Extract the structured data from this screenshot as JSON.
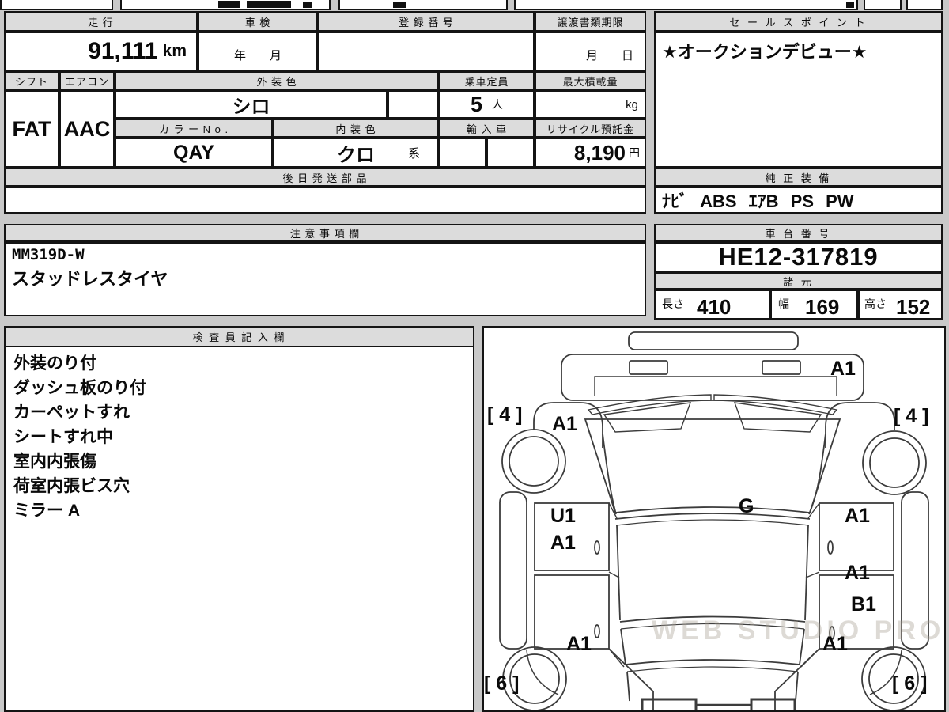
{
  "page": {
    "background": "#c9c9c9"
  },
  "vehicle_table": {
    "headers": {
      "mileage": "走 行",
      "inspection": "車 検",
      "registration": "登 録 番 号",
      "transfer_deadline": "譲渡書類期限",
      "shift": "シフト",
      "aircon": "エアコン",
      "exterior_color": "外 装 色",
      "capacity": "乗車定員",
      "max_load": "最大積載量",
      "color_no": "カ ラ ー N o .",
      "interior_color": "内 装 色",
      "imported": "輸 入 車",
      "recycle_deposit": "リサイクル預託金",
      "later_shipped_parts": "後 日 発 送 部 品"
    },
    "values": {
      "mileage": "91,111",
      "mileage_unit": "km",
      "inspection_placeholder": "年　　月",
      "transfer_placeholder": "月　　日",
      "shift": "FAT",
      "aircon": "AAC",
      "exterior_color": "シロ",
      "capacity": "5",
      "capacity_unit": "人",
      "max_load_unit": "kg",
      "color_no": "QAY",
      "interior_color": "クロ",
      "interior_color_suffix": "系",
      "recycle_deposit": "8,190",
      "recycle_deposit_unit": "円"
    }
  },
  "sales_point": {
    "header": "セ ー ル ス ポ イ ン ト",
    "text": "★オークションデビュー★"
  },
  "equipment": {
    "header": "純 正 装 備",
    "text": "ﾅﾋﾞ ABS ｴｱB PS PW"
  },
  "notes": {
    "header": "注 意 事 項 欄",
    "lines": [
      "MM319D-W",
      "スタッドレスタイヤ"
    ]
  },
  "chassis": {
    "header": "車 台 番 号",
    "value": "HE12-317819"
  },
  "specs": {
    "header": "諸 元",
    "length_label": "長さ",
    "length_value": "410",
    "width_label": "幅",
    "width_value": "169",
    "height_label": "高さ",
    "height_value": "152"
  },
  "inspector": {
    "header": "検 査 員 記 入 欄",
    "lines": [
      "外装のり付",
      "ダッシュ板のり付",
      "カーペットすれ",
      "シートすれ中",
      "室内内張傷",
      "荷室内張ビス穴",
      "ミラー A"
    ]
  },
  "diagram": {
    "watermark": "WEB STUDIO PRO",
    "labels": [
      "A1",
      "[ 4 ]",
      "[ 4 ]",
      "A1",
      "U1",
      "A1",
      "G",
      "A1",
      "A1",
      "B1",
      "A1",
      "A1",
      "[ 6 ]",
      "[ 6 ]"
    ]
  }
}
